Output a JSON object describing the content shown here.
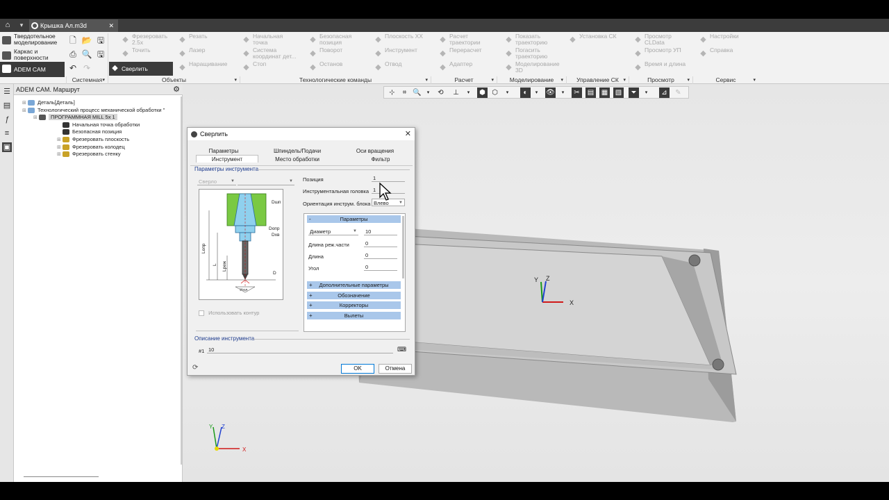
{
  "window": {
    "tab_title": "Крышка Ал.m3d"
  },
  "modes": [
    {
      "label": "Твердотельное моделирование"
    },
    {
      "label": "Каркас и поверхности"
    },
    {
      "label": "ADEM CAM"
    }
  ],
  "ribbon": {
    "buttons": [
      {
        "label": "Фрезеровать 2.5x",
        "col": 0,
        "row": 0
      },
      {
        "label": "Точить",
        "col": 0,
        "row": 1
      },
      {
        "label": "Сверлить",
        "col": 0,
        "row": 2
      },
      {
        "label": "Резать",
        "col": 1,
        "row": 0
      },
      {
        "label": "Лазер",
        "col": 1,
        "row": 1
      },
      {
        "label": "Наращивание",
        "col": 1,
        "row": 2
      },
      {
        "label": "Начальная точка",
        "col": 2,
        "row": 0
      },
      {
        "label": "Система координат дет...",
        "col": 2,
        "row": 1
      },
      {
        "label": "Стоп",
        "col": 2,
        "row": 2
      },
      {
        "label": "Безопасная позиция",
        "col": 3,
        "row": 0
      },
      {
        "label": "Поворот",
        "col": 3,
        "row": 1
      },
      {
        "label": "Останов",
        "col": 3,
        "row": 2
      },
      {
        "label": "Плоскость XX",
        "col": 4,
        "row": 0
      },
      {
        "label": "Инструмент",
        "col": 4,
        "row": 1
      },
      {
        "label": "Отвод",
        "col": 4,
        "row": 2
      },
      {
        "label": "Расчет траектории",
        "col": 5,
        "row": 0
      },
      {
        "label": "Перерасчет",
        "col": 5,
        "row": 1
      },
      {
        "label": "Адаптер",
        "col": 5,
        "row": 2
      },
      {
        "label": "Показать траекторию",
        "col": 6,
        "row": 0
      },
      {
        "label": "Погасить траекторию",
        "col": 6,
        "row": 1
      },
      {
        "label": "Моделирование 3D",
        "col": 6,
        "row": 2
      },
      {
        "label": "Установка СК",
        "col": 7,
        "row": 0
      },
      {
        "label": "Просмотр CLData",
        "col": 8,
        "row": 0
      },
      {
        "label": "Просмотр УП",
        "col": 8,
        "row": 1
      },
      {
        "label": "Время и длина",
        "col": 8,
        "row": 2
      },
      {
        "label": "Настройки",
        "col": 9,
        "row": 0
      },
      {
        "label": "Справка",
        "col": 9,
        "row": 1
      }
    ],
    "groups": [
      {
        "label": "Системная"
      },
      {
        "label": "Объекты"
      },
      {
        "label": "Технологические команды"
      },
      {
        "label": "Расчет"
      },
      {
        "label": "Моделирование"
      },
      {
        "label": "Управление СК"
      },
      {
        "label": "Просмотр"
      },
      {
        "label": "Сервис"
      }
    ]
  },
  "tree": {
    "title": "ADEM CAM. Маршрут",
    "nodes": [
      {
        "label": "Деталь[Деталь]",
        "level": 0,
        "icon_color": "#7aa7d6"
      },
      {
        "label": "Технологический процесс механической обработки \"",
        "level": 0,
        "icon_color": "#7aa7d6"
      },
      {
        "label": "ПРОГРАММНАЯ MILL 5x 1",
        "level": 1,
        "icon_color": "#555555"
      },
      {
        "label": "Начальная точка обработки",
        "level": 2,
        "icon_color": "#333333"
      },
      {
        "label": "Безопасная позиция",
        "level": 2,
        "icon_color": "#333333"
      },
      {
        "label": "Фрезеровать плоскость",
        "level": 2,
        "icon_color": "#c9a227"
      },
      {
        "label": "Фрезеровать колодец",
        "level": 2,
        "icon_color": "#c9a227"
      },
      {
        "label": "Фрезеровать стенку",
        "level": 2,
        "icon_color": "#c9a227"
      }
    ]
  },
  "dialog": {
    "title": "Сверлить",
    "tabs_row1": [
      "Параметры",
      "Шпиндель/Подачи",
      "Оси вращения"
    ],
    "tabs_row2": [
      "Инструмент",
      "Место обработки",
      "Фильтр"
    ],
    "tool_params_label": "Параметры инструмента",
    "tool_type": "Сверло",
    "position_label": "Позиция",
    "position_value": "1",
    "head_label": "Инструментальная головка",
    "head_value": "1",
    "orientation_label": "Ориентация инструм. блока",
    "orientation_value": "Влево",
    "params_section": "Параметры",
    "diameter_label": "Диаметр",
    "diameter_value": "10",
    "cut_length_label": "Длина реж.части",
    "cut_length_value": "0",
    "length_label": "Длина",
    "length_value": "0",
    "angle_label": "Угол",
    "angle_value": "0",
    "sections": [
      "Дополнительные параметры",
      "Обозначение",
      "Корректоры",
      "Вылеты"
    ],
    "use_contour": "Использовать контур",
    "description_label": "Описание инструмента",
    "description_prefix": "#1",
    "description_value": "10",
    "ok": "OK",
    "cancel": "Отмена",
    "drawing_labels": [
      "Dшп",
      "Dопр",
      "Dхв",
      "D",
      "Lопр",
      "L",
      "Lреж",
      "Угол"
    ]
  },
  "axes": {
    "x": "X",
    "y": "Y",
    "z": "Z"
  }
}
